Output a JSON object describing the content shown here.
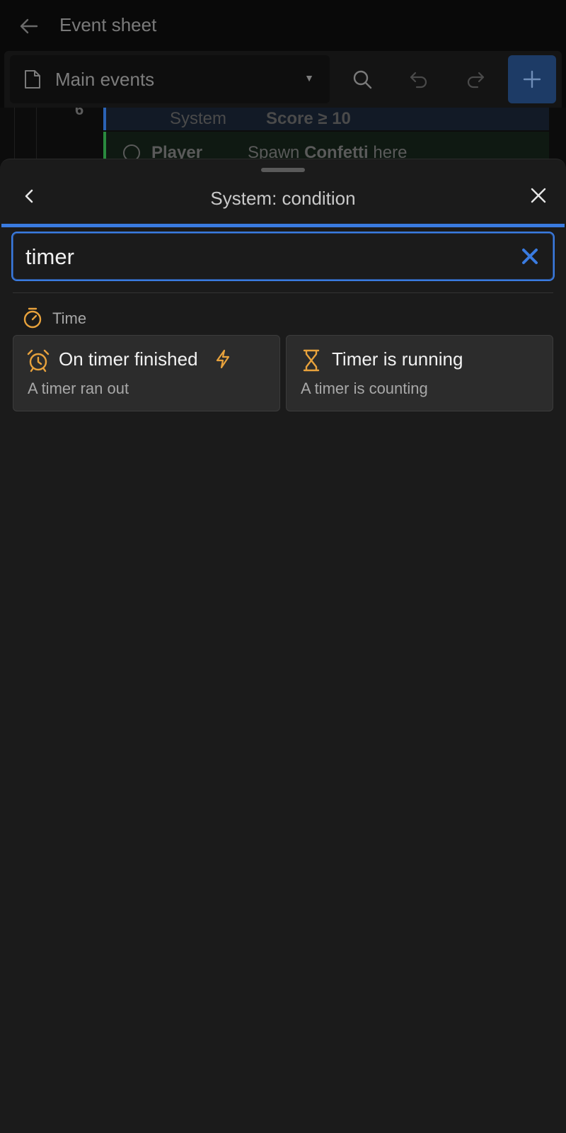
{
  "app_bar": {
    "title": "Event sheet"
  },
  "toolbar": {
    "sheet_name": "Main events"
  },
  "events": {
    "row_number": "6",
    "row1": {
      "object": "System",
      "expression_bold": "Score ≥ 10",
      "expression": ""
    },
    "row2": {
      "object": "Player",
      "action_prefix": "Spawn ",
      "action_bold": "Confetti",
      "action_suffix": " here"
    }
  },
  "sheet": {
    "title": "System: condition",
    "search": {
      "value": "timer",
      "placeholder": ""
    },
    "category": {
      "label": "Time",
      "icon": "stopwatch-icon"
    },
    "results": [
      {
        "title": "On timer finished",
        "description": "A timer ran out",
        "icon": "alarm-clock-icon",
        "trigger_icon": "lightning-icon"
      },
      {
        "title": "Timer is running",
        "description": "A timer is counting",
        "icon": "hourglass-icon"
      }
    ]
  },
  "colors": {
    "accent": "#3a7be0",
    "icon_orange": "#e8a23c",
    "trigger_yellow": "#e8a23c",
    "card_bg": "#2c2c2c",
    "sheet_bg": "#1b1b1b"
  }
}
